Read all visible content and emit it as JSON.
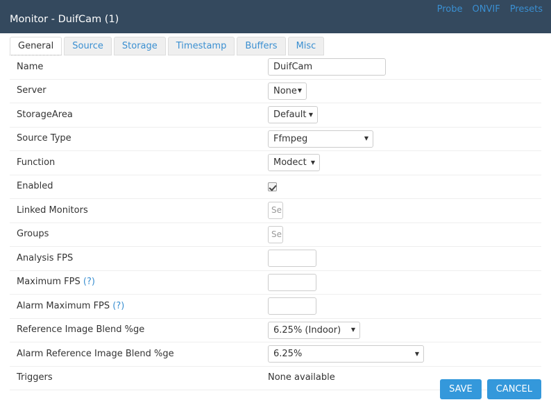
{
  "header": {
    "title": "Monitor - DuifCam (1)",
    "links": [
      {
        "label": "Probe",
        "name": "probe"
      },
      {
        "label": "ONVIF",
        "name": "onvif"
      },
      {
        "label": "Presets",
        "name": "presets"
      }
    ],
    "background_color": "#34495e",
    "link_color": "#3a8fd1"
  },
  "tabs": [
    {
      "label": "General",
      "active": true
    },
    {
      "label": "Source",
      "active": false
    },
    {
      "label": "Storage",
      "active": false
    },
    {
      "label": "Timestamp",
      "active": false
    },
    {
      "label": "Buffers",
      "active": false
    },
    {
      "label": "Misc",
      "active": false
    }
  ],
  "form": {
    "name": {
      "label": "Name",
      "value": "DuifCam"
    },
    "server": {
      "label": "Server",
      "value": "None"
    },
    "storage_area": {
      "label": "StorageArea",
      "value": "Default"
    },
    "source_type": {
      "label": "Source Type",
      "value": "Ffmpeg"
    },
    "function": {
      "label": "Function",
      "value": "Modect"
    },
    "enabled": {
      "label": "Enabled",
      "checked": true
    },
    "linked_monitors": {
      "label": "Linked Monitors",
      "value": "Select"
    },
    "groups": {
      "label": "Groups",
      "value": "Select"
    },
    "analysis_fps": {
      "label": "Analysis FPS",
      "value": ""
    },
    "maximum_fps": {
      "label": "Maximum FPS",
      "help": "(?)",
      "value": ""
    },
    "alarm_maximum_fps": {
      "label": "Alarm Maximum FPS",
      "help": "(?)",
      "value": ""
    },
    "reference_image_blend": {
      "label": "Reference Image Blend %ge",
      "value": "6.25% (Indoor)"
    },
    "alarm_reference_image_blend": {
      "label": "Alarm Reference Image Blend %ge",
      "value": "6.25%"
    },
    "triggers": {
      "label": "Triggers",
      "value": "None available"
    }
  },
  "footer": {
    "save_label": "SAVE",
    "cancel_label": "CANCEL",
    "button_color": "#3498db"
  },
  "icons": {
    "dropdown_arrow": "▼"
  }
}
